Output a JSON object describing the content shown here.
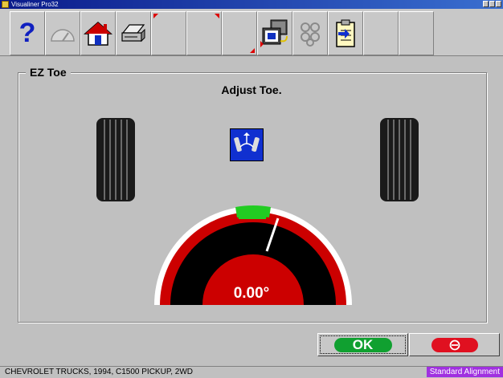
{
  "window": {
    "title": "Visualiner Pro32"
  },
  "toolbar": {
    "buttons": [
      {
        "name": "help-icon"
      },
      {
        "name": "gauge-icon"
      },
      {
        "name": "home-icon"
      },
      {
        "name": "printer-icon"
      },
      {
        "name": "blank-1"
      },
      {
        "name": "blank-2"
      },
      {
        "name": "blank-3"
      },
      {
        "name": "display-icon"
      },
      {
        "name": "molecule-icon"
      },
      {
        "name": "clipboard-icon"
      },
      {
        "name": "blank-4"
      },
      {
        "name": "blank-5"
      }
    ]
  },
  "panel": {
    "title": "EZ Toe",
    "instruction": "Adjust Toe."
  },
  "gauge": {
    "value": "0.00°",
    "needle_position": 0.0
  },
  "buttons": {
    "ok_label": "OK"
  },
  "status": {
    "vehicle": "CHEVROLET TRUCKS, 1994, C1500 PICKUP, 2WD",
    "mode": "Standard Alignment"
  },
  "colors": {
    "accent_ok": "#10a030",
    "accent_cancel": "#e01020",
    "gauge_red": "#cc0000",
    "gauge_green": "#22cc22",
    "mode_badge": "#a030e0"
  }
}
